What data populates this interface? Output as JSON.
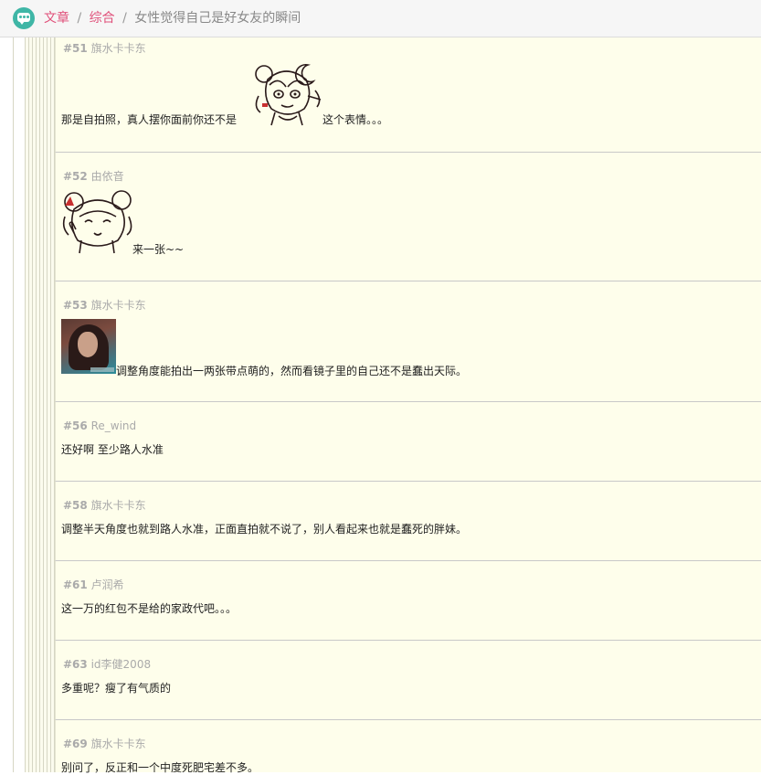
{
  "breadcrumb": {
    "section": "文章",
    "separator": "/",
    "category": "综合",
    "title": "女性觉得自己是好女友的瞬间"
  },
  "colors": {
    "accent": "#e0507a",
    "logo": "#3fb6a6",
    "post_background": "#fefeeb",
    "meta_text": "#aaaaaa"
  },
  "posts": [
    {
      "floor": "#51",
      "user": "旗水卡卡东",
      "before": "那是自拍照，真人摆你面前你还不是",
      "after": "这个表情。。。",
      "emote": "manga-smoking-girl-emote"
    },
    {
      "floor": "#52",
      "user": "由依音",
      "after": "来一张~~",
      "emote": "manga-thumbs-girl-emote"
    },
    {
      "floor": "#53",
      "user": "旗水卡卡东",
      "after": "调整角度能拍出一两张带点萌的，然而看镜子里的自己还不是蠢出天际。",
      "photo": "selfie-photo"
    },
    {
      "floor": "#56",
      "user": "Re_wind",
      "text": "还好啊 至少路人水准"
    },
    {
      "floor": "#58",
      "user": "旗水卡卡东",
      "text": "调整半天角度也就到路人水准，正面直拍就不说了，别人看起来也就是蠢死的胖妹。"
    },
    {
      "floor": "#61",
      "user": "卢润希",
      "text": "这一万的红包不是给的家政代吧。。。"
    },
    {
      "floor": "#63",
      "user": "id李健2008",
      "text": "多重呢？瘦了有气质的"
    },
    {
      "floor": "#69",
      "user": "旗水卡卡东",
      "text": "别问了，反正和一个中度死肥宅差不多。"
    }
  ]
}
